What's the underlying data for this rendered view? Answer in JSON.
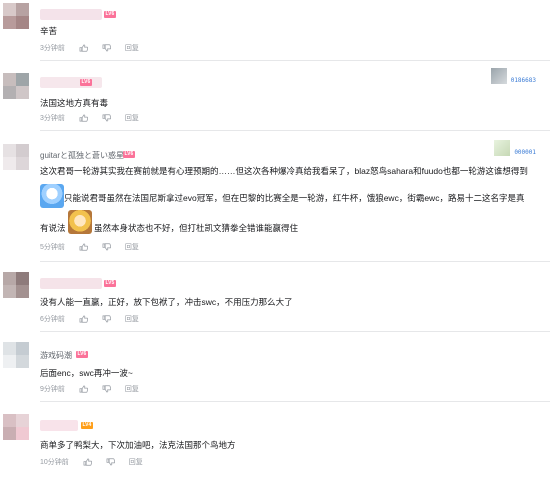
{
  "colors": {
    "accent": "#fb7299",
    "meta": "#9499a0",
    "text": "#18191c",
    "lv_orange": "#ff9f19"
  },
  "icons": {
    "like": "thumb-up-icon",
    "dislike": "thumb-down-icon"
  },
  "reply_label": "回复",
  "comments": [
    {
      "username": "",
      "level": "LV6",
      "text": "辛苦",
      "time": "3分钟前"
    },
    {
      "username": "",
      "level": "LV6",
      "text": "法国这地方真有毒",
      "time": "3分钟前",
      "badge_number": "0186683"
    },
    {
      "username": "guitarと孤独と蒼い惑星",
      "level": "LV6",
      "lines": [
        "这次君哥一轮游其实我在赛前就是有心理预期的……但这次各种爆冷真给我看呆了，blaz怒鸟sahara和fuudo也都一轮游这谁想得到",
        "只能说君哥虽然在法国尼斯拿过evo冠军，但在巴黎的比赛全是一轮游，红牛杯，饿狼ewc，街霸ewc，路易十二这名字是真",
        "有说法",
        "虽然本身状态也不好，但打杜凯文猜拳全错谁能赢得住"
      ],
      "time": "5分钟前",
      "badge_number": "000001"
    },
    {
      "username": "",
      "level": "LV5",
      "text": "没有人能一直赢，正好，放下包袱了，冲击swc，不用压力那么大了",
      "time": "6分钟前"
    },
    {
      "username": "游戏码潮",
      "level": "LV6",
      "text": "后面enc，swc再冲一波~",
      "time": "9分钟前"
    },
    {
      "username": "",
      "level": "LV4",
      "text": "商单多了鸭梨大，下次加油吧，法克法国那个鸟地方",
      "time": "10分钟前"
    }
  ]
}
